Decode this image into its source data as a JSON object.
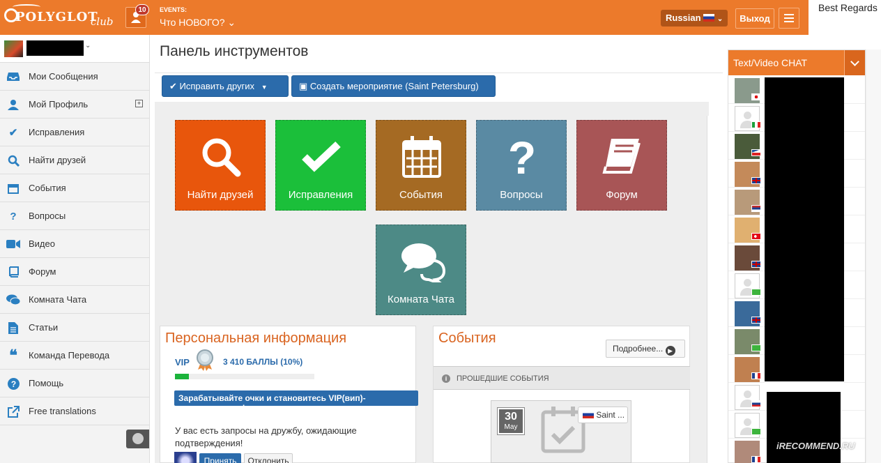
{
  "header": {
    "logo_text": "POLYGLOT",
    "logo_club": "club",
    "notifications_count": "10",
    "events_caption": "EVENTS:",
    "events_select": "Что НОВОГО? ⌄",
    "language": "Russian",
    "logout": "Выход",
    "best_regards": "Best Regards"
  },
  "sidebar": {
    "items": [
      {
        "label": "Мои Сообщения",
        "icon": "inbox-icon"
      },
      {
        "label": "Мой Профиль",
        "icon": "user-icon"
      },
      {
        "label": "Исправления",
        "icon": "check-icon"
      },
      {
        "label": "Найти друзей",
        "icon": "search-icon"
      },
      {
        "label": "События",
        "icon": "calendar-icon"
      },
      {
        "label": "Вопросы",
        "icon": "question-icon"
      },
      {
        "label": "Видео",
        "icon": "video-icon"
      },
      {
        "label": "Форум",
        "icon": "book-icon"
      },
      {
        "label": "Комната Чата",
        "icon": "chat-icon"
      },
      {
        "label": "Статьи",
        "icon": "file-icon"
      },
      {
        "label": "Команда Перевода",
        "icon": "quote-icon"
      },
      {
        "label": "Помощь",
        "icon": "help-icon"
      },
      {
        "label": "Free translations",
        "icon": "external-link-icon"
      }
    ]
  },
  "main": {
    "title": "Панель инструментов",
    "btn_correct": "Исправить других",
    "btn_create_event": "Создать мероприятие (Saint Petersburg)",
    "tiles": [
      {
        "label": "Найти друзей",
        "color": "#e8560c"
      },
      {
        "label": "Исправления",
        "color": "#1bbf3a"
      },
      {
        "label": "События",
        "color": "#a56a23"
      },
      {
        "label": "Вопросы",
        "color": "#5a8aa3"
      },
      {
        "label": "Форум",
        "color": "#a85556"
      },
      {
        "label": "Комната Чата",
        "color": "#4d8a86"
      }
    ]
  },
  "personal": {
    "title": "Персональная информация",
    "vip": "VIP",
    "points": "3 410 БАЛЛЫ (10%)",
    "progress_percent": 10,
    "earn_banner": "Зарабатывайте очки и становитесь VIP(вип)-пользователем!",
    "friend_requests": "У вас есть запросы на дружбу, ожидающие подтверждения!",
    "accept": "Принять",
    "decline": "Отклонить"
  },
  "events_panel": {
    "title": "События",
    "more": "Подробнее...",
    "past_label": "ПРОШЕДШИЕ СОБЫТИЯ",
    "event_day": "30",
    "event_month": "May",
    "event_city": "Saint ..."
  },
  "chat": {
    "title": "Text/Video CHAT",
    "users": [
      {
        "avatar": "photo",
        "flag": "jp"
      },
      {
        "avatar": "placeholder",
        "flag": "it"
      },
      {
        "avatar": "photo",
        "flag": "cz"
      },
      {
        "avatar": "photo",
        "flag": "gb"
      },
      {
        "avatar": "photo",
        "flag": "rs"
      },
      {
        "avatar": "photo",
        "flag": "tr"
      },
      {
        "avatar": "photo",
        "flag": "gb"
      },
      {
        "avatar": "placeholder",
        "flag": "online"
      },
      {
        "avatar": "photo",
        "flag": "gb"
      },
      {
        "avatar": "photo",
        "flag": "online"
      },
      {
        "avatar": "photo",
        "flag": "fr"
      },
      {
        "avatar": "placeholder",
        "flag": "ru"
      },
      {
        "avatar": "placeholder",
        "flag": "online"
      },
      {
        "avatar": "photo",
        "flag": "fr"
      }
    ]
  },
  "watermark": "iRECOMMEND.RU"
}
